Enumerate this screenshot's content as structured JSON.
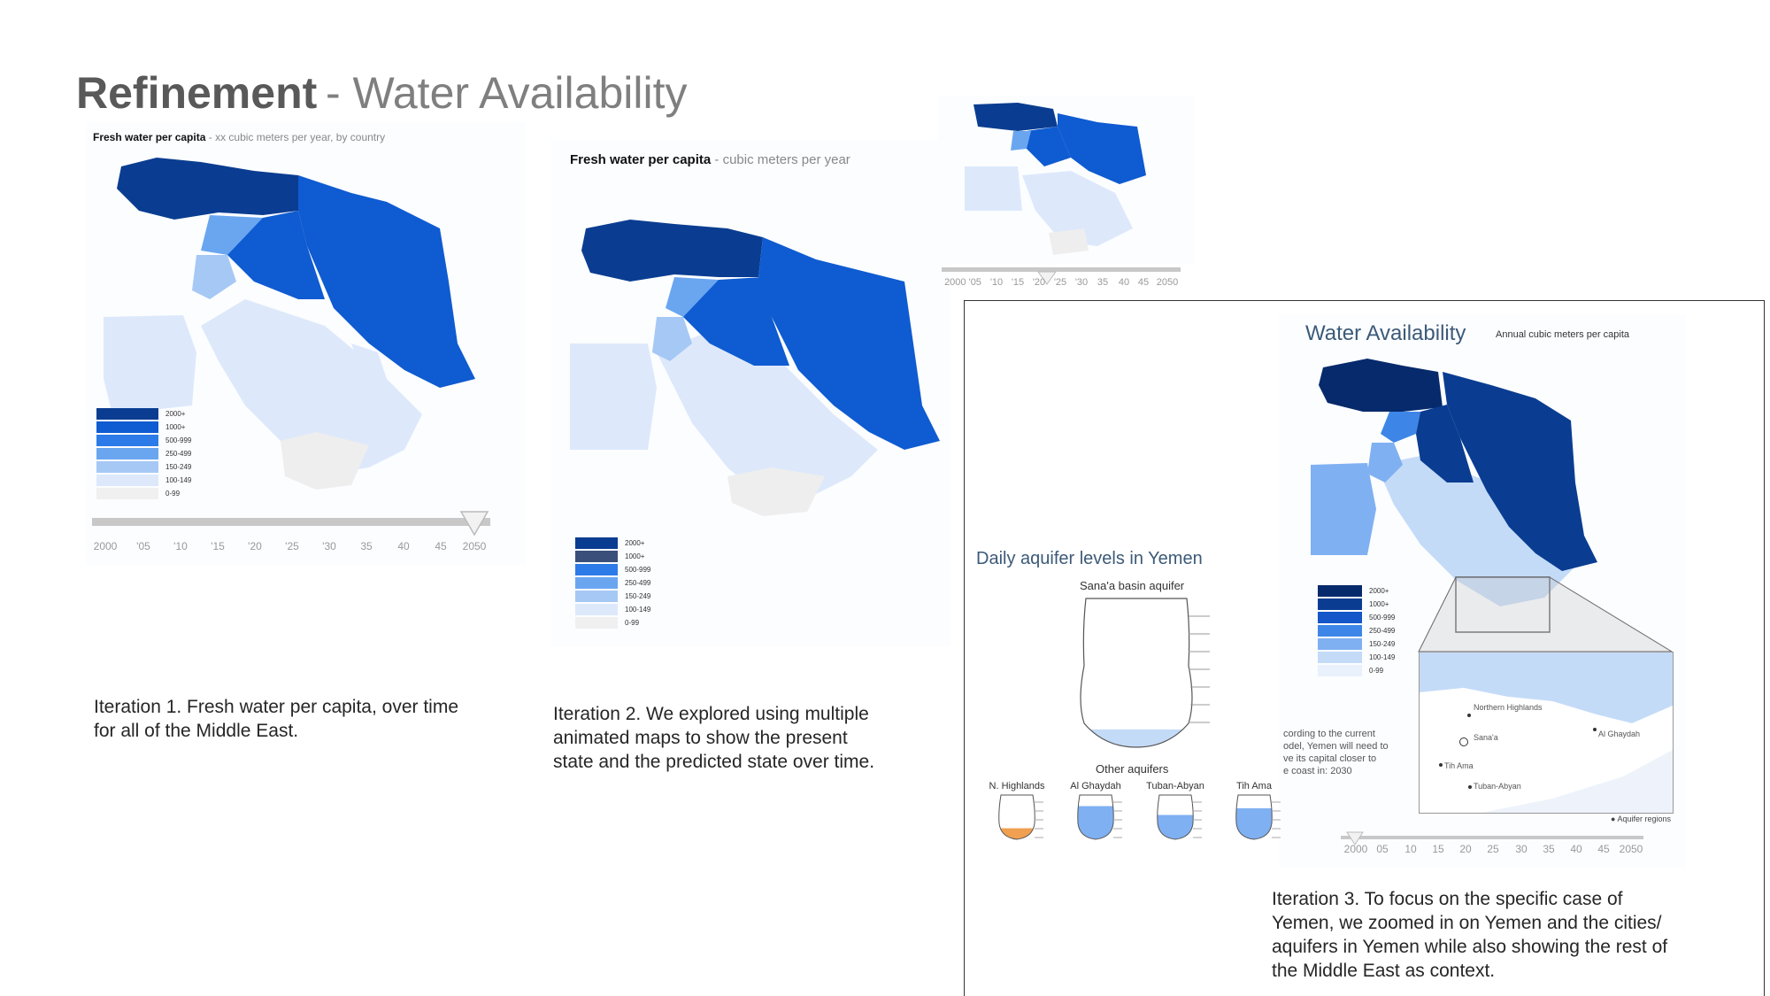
{
  "slide": {
    "title_bold": "Refinement",
    "title_light": "- Water Availability"
  },
  "panel1": {
    "title_bold": "Fresh water per capita",
    "title_light": "- xx cubic meters per year, by country",
    "legend": [
      "2000+",
      "1000+",
      "500-999",
      "250-499",
      "150-249",
      "100-149",
      "0-99"
    ],
    "legend_colors": [
      "#0a3d91",
      "#0f5bd1",
      "#2d7be8",
      "#6aa6f0",
      "#a6c8f5",
      "#dde9fb",
      "#f0f0f0"
    ],
    "timeline": [
      "2000",
      "'05",
      "'10",
      "'15",
      "'20",
      "'25",
      "'30",
      "35",
      "40",
      "45",
      "2050"
    ],
    "timeline_value": "2050",
    "caption": [
      "Iteration 1.  Fresh water per capita, over time",
      "for all of the Middle East."
    ]
  },
  "panel2": {
    "title_bold": "Fresh water per capita",
    "title_light": "- cubic meters per year",
    "legend": [
      "2000+",
      "1000+",
      "500-999",
      "250-499",
      "150-249",
      "100-149",
      "0-99"
    ],
    "legend_colors": [
      "#0a3d91",
      "#3a4f7a",
      "#2d7be8",
      "#6aa6f0",
      "#a6c8f5",
      "#dde9fb",
      "#f0f0f0"
    ],
    "mini_timeline": [
      "2000 '05",
      "'10",
      "'15",
      "'20",
      "'25",
      "'30",
      "35",
      "40",
      "45",
      "2050"
    ],
    "caption": [
      "Iteration 2.  We explored using multiple",
      "animated  maps to show the present",
      "state and the predicted state over time."
    ]
  },
  "panel3": {
    "title": "Water Availability",
    "subtitle": "Annual cubic meters per capita",
    "legend": [
      "2000+",
      "1000+",
      "500-999",
      "250-499",
      "150-249",
      "100-149",
      "0-99"
    ],
    "legend_colors": [
      "#062a6b",
      "#0a3d91",
      "#1556c9",
      "#3d86e8",
      "#7fb0f2",
      "#c4dbf8",
      "#e9f1fc"
    ],
    "aquifer_heading": "Daily aquifer levels in Yemen",
    "main_aquifer": "Sana'a basin aquifer",
    "main_aquifer_level": 0.12,
    "other_heading": "Other aquifers",
    "other_aquifers": [
      {
        "name": "N. Highlands",
        "level": 0.25,
        "color": "#f0a050"
      },
      {
        "name": "Al Ghaydah",
        "level": 0.75,
        "color": "#7fb0f2"
      },
      {
        "name": "Tuban-Abyan",
        "level": 0.55,
        "color": "#7fb0f2"
      },
      {
        "name": "Tih Ama",
        "level": 0.7,
        "color": "#7fb0f2"
      }
    ],
    "note": [
      "cording to the current",
      "odel, Yemen will need to",
      "ve its capital closer to",
      "e coast in: 2030"
    ],
    "cities": [
      "Northern Highlands",
      "Sana'a",
      "Al Ghaydah",
      "Tih Ama",
      "Tuban-Abyan"
    ],
    "inset_legend": "Aquifer regions",
    "timeline": [
      "2000",
      "05",
      "10",
      "15",
      "20",
      "25",
      "30",
      "35",
      "40",
      "45",
      "2050"
    ],
    "timeline_value": "2000",
    "caption": [
      "Iteration 3. To focus on the specific case of",
      "Yemen, we zoomed in on Yemen and the cities/",
      "aquifers in Yemen while also showing the rest of",
      "the Middle East as context."
    ]
  }
}
